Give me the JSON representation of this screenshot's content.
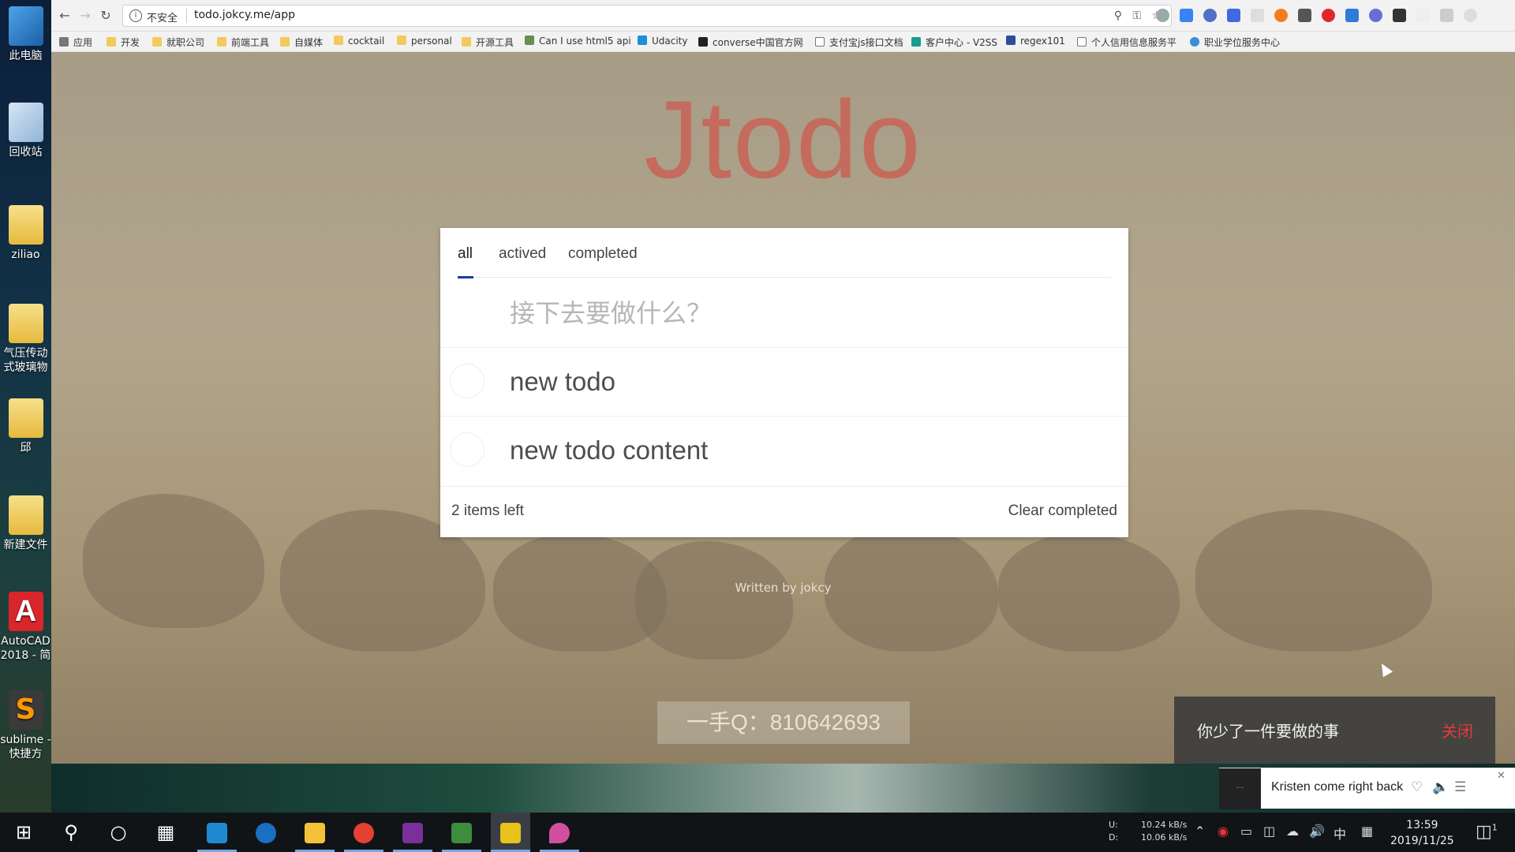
{
  "desktop": {
    "icons": [
      {
        "label": "此电脑"
      },
      {
        "label": "回收站"
      },
      {
        "label": "ziliao"
      },
      {
        "label": "气压传动式玻璃物"
      },
      {
        "label": "邱"
      },
      {
        "label": "新建文件"
      },
      {
        "label": "AutoCAD 2018 - 简"
      },
      {
        "label": "sublime - 快捷方"
      }
    ]
  },
  "browser": {
    "security_label": "不安全",
    "url": "todo.jokcy.me/app",
    "bookmarks": [
      {
        "label": "应用",
        "icon": "apps-grid-icon"
      },
      {
        "label": "开发",
        "icon": "folder-icon"
      },
      {
        "label": "就职公司",
        "icon": "folder-icon"
      },
      {
        "label": "前端工具",
        "icon": "folder-icon"
      },
      {
        "label": "自媒体",
        "icon": "folder-icon"
      },
      {
        "label": "cocktail",
        "icon": "folder-icon"
      },
      {
        "label": "personal",
        "icon": "folder-icon"
      },
      {
        "label": "开源工具",
        "icon": "folder-icon"
      },
      {
        "label": "Can I use html5 api",
        "icon": "image-icon"
      },
      {
        "label": "Udacity",
        "icon": "udacity-icon"
      },
      {
        "label": "converse中国官方网",
        "icon": "converse-icon"
      },
      {
        "label": "支付宝js接口文档",
        "icon": "page-icon"
      },
      {
        "label": "客户中心 - V2SS",
        "icon": "v-icon"
      },
      {
        "label": "regex101",
        "icon": "r-icon"
      },
      {
        "label": "个人信用信息服务平",
        "icon": "page-icon"
      },
      {
        "label": "职业学位服务中心",
        "icon": "globe-icon"
      }
    ]
  },
  "app": {
    "title": "Jtodo",
    "tabs": [
      {
        "label": "all",
        "active": true
      },
      {
        "label": "actived",
        "active": false
      },
      {
        "label": "completed",
        "active": false
      }
    ],
    "input_placeholder": "接下去要做什么？",
    "todos": [
      {
        "text": "new todo",
        "completed": false
      },
      {
        "text": "new todo content",
        "completed": false
      }
    ],
    "items_left": "2 items left",
    "clear_completed": "Clear completed",
    "footer_text": "Written by jokcy",
    "accent_color": "#1a3aa8",
    "title_color": "#c46b5e"
  },
  "watermark": "一手Q：810642693",
  "toast": {
    "message": "你少了一件要做的事",
    "close_label": "关闭",
    "close_color": "#e23b3b"
  },
  "music_widget": {
    "title": "Kristen come right back"
  },
  "taskbar": {
    "net_labels": [
      "U:",
      "D:"
    ],
    "net_up": "10.24 kB/s",
    "net_down": "10.06 kB/s",
    "ime": "中",
    "time": "13:59",
    "date": "2019/11/25",
    "notification_count": "1"
  }
}
